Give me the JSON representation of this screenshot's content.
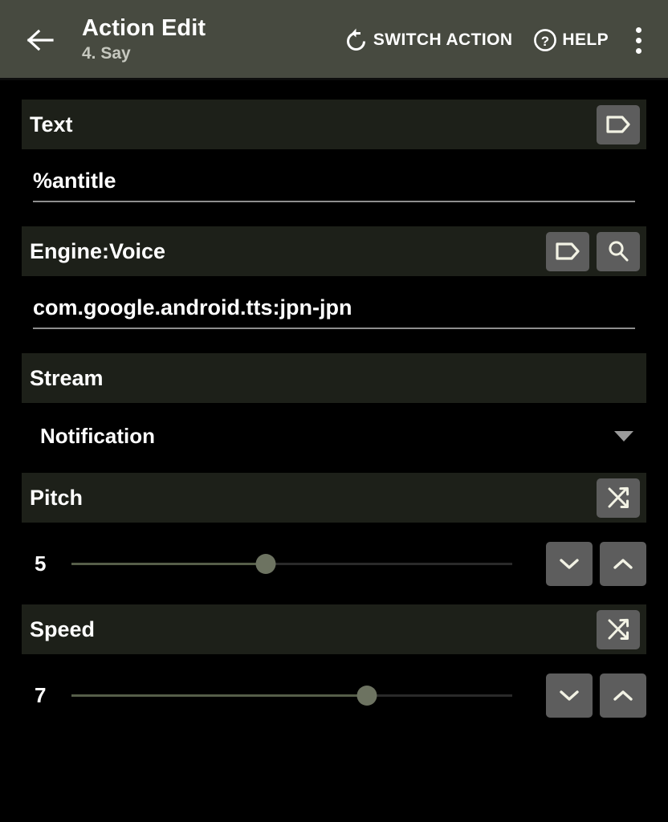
{
  "appbar": {
    "back_icon": "arrow-left-icon",
    "title": "Action Edit",
    "subtitle": "4. Say",
    "switch_action": {
      "icon": "rotate-ccw-icon",
      "label": "SWITCH ACTION"
    },
    "help": {
      "icon": "question-circle-icon",
      "label": "HELP"
    },
    "overflow_icon": "more-vertical-icon",
    "background_color": "#474a40"
  },
  "colors": {
    "page_background": "#000000",
    "section_header_background": "#1d2019",
    "icon_button_background": "#5d5d5d",
    "icon_glyph": "#f2f2e4",
    "underline": "#8e8e8e",
    "slider_fill": "#565e49",
    "slider_track": "#2a2a2a",
    "slider_thumb": "#6d7361"
  },
  "sections": {
    "text": {
      "title": "Text",
      "tag_icon": "tag-icon",
      "value": "%antitle"
    },
    "engine_voice": {
      "title": "Engine:Voice",
      "tag_icon": "tag-icon",
      "search_icon": "search-icon",
      "value": "com.google.android.tts:jpn-jpn"
    },
    "stream": {
      "title": "Stream",
      "selected": "Notification",
      "dropdown_icon": "chevron-down-icon"
    },
    "pitch": {
      "title": "Pitch",
      "shuffle_icon": "shuffle-icon",
      "value": "5",
      "slider_percent": 44,
      "decrement_icon": "chevron-down-icon",
      "increment_icon": "chevron-up-icon"
    },
    "speed": {
      "title": "Speed",
      "shuffle_icon": "shuffle-icon",
      "value": "7",
      "slider_percent": 67,
      "decrement_icon": "chevron-down-icon",
      "increment_icon": "chevron-up-icon"
    }
  }
}
